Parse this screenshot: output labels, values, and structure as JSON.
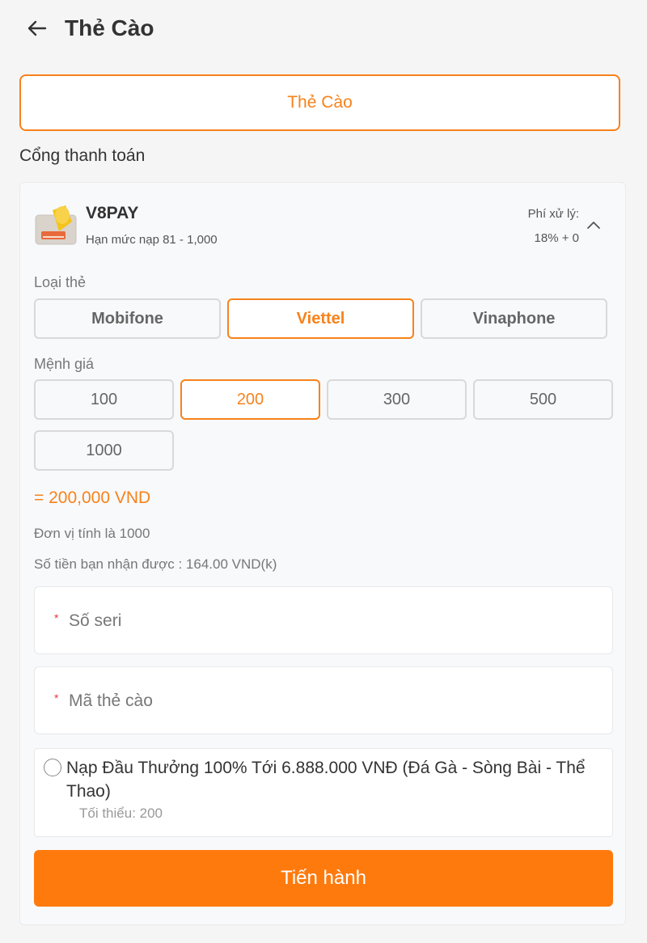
{
  "header": {
    "title": "Thẻ Cào",
    "back_icon": "arrow-left-icon"
  },
  "method_tab": {
    "label": "Thẻ Cào"
  },
  "gateway_section": {
    "label": "Cổng thanh toán"
  },
  "provider": {
    "name": "V8PAY",
    "limit": "Hạn mức nạp 81 - 1,000",
    "fee_label": "Phí xử lý:",
    "fee_value": "18% + 0",
    "collapse_icon": "chevron-up-icon"
  },
  "card_type": {
    "label": "Loại thẻ",
    "options": [
      "Mobifone",
      "Viettel",
      "Vinaphone"
    ],
    "selected": "Viettel"
  },
  "denomination": {
    "label": "Mệnh giá",
    "options": [
      "100",
      "200",
      "300",
      "500",
      "1000"
    ],
    "selected": "200"
  },
  "summary": {
    "amount": "= 200,000 VND",
    "unit_note": "Đơn vị tính là 1000",
    "receive_note": "Số tiền bạn nhận được : 164.00 VND(k)"
  },
  "form": {
    "serial_placeholder": "Số seri",
    "code_placeholder": "Mã thẻ cào",
    "required_mark": "*"
  },
  "promo": {
    "title": "Nạp Đầu Thưởng 100% Tới 6.888.000 VNĐ (Đá Gà - Sòng Bài - Thể Thao)",
    "min": "Tối thiểu: 200",
    "checked": false
  },
  "submit": {
    "label": "Tiến hành"
  },
  "colors": {
    "accent": "#f7821b",
    "button": "#ff7a0d",
    "required": "#e53935"
  }
}
